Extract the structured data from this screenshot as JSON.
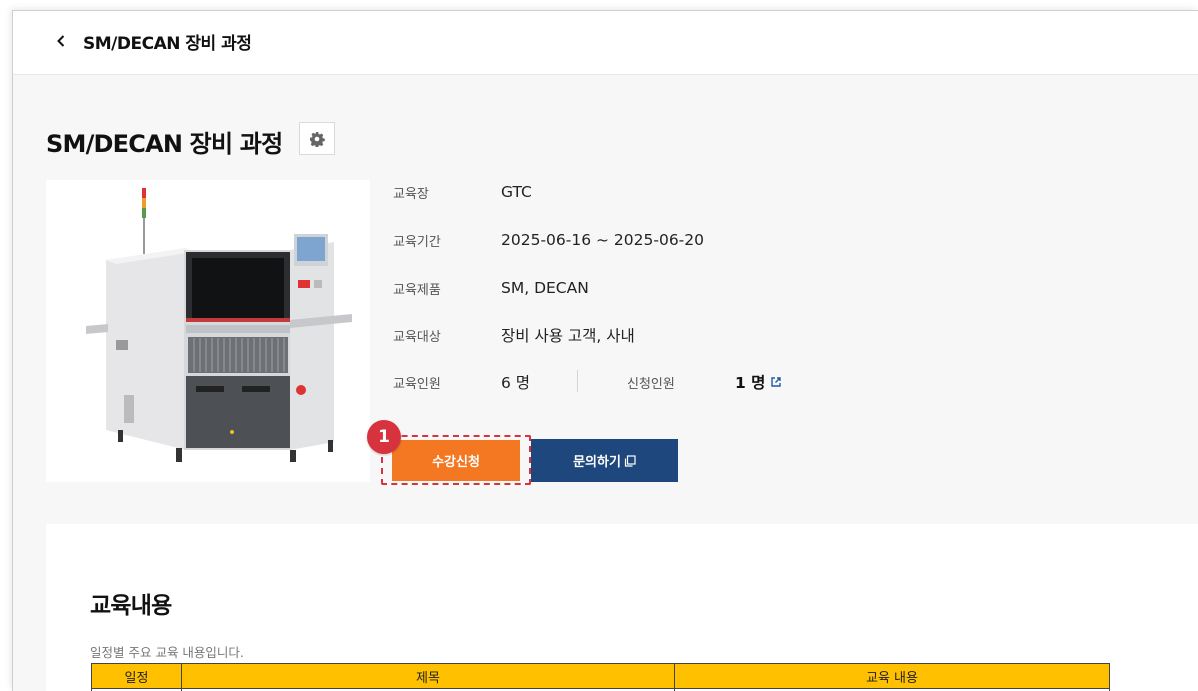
{
  "header": {
    "title": "SM/DECAN 장비 과정"
  },
  "course": {
    "title": "SM/DECAN 장비 과정",
    "info": {
      "venue_label": "교육장",
      "venue_value": "GTC",
      "period_label": "교육기간",
      "period_value": "2025-06-16 ~ 2025-06-20",
      "products_label": "교육제품",
      "products_value": "SM, DECAN",
      "target_label": "교육대상",
      "target_value": "장비 사용 고객, 사내",
      "capacity_label": "교육인원",
      "capacity_value": "6 명",
      "applied_label": "신청인원",
      "applied_value": "1 명"
    },
    "buttons": {
      "apply": "수강신청",
      "inquiry": "문의하기"
    },
    "step_badge": "1"
  },
  "content": {
    "title": "교육내용",
    "subtitle": "일정별 주요 교육 내용입니다.",
    "table_headers": [
      "일정",
      "제목",
      "교육 내용"
    ]
  },
  "colors": {
    "apply_button": "#f47721",
    "inquiry_button": "#1e477d",
    "highlight": "#d9333f",
    "table_header": "#ffc000"
  },
  "icons": {
    "back": "chevron-left-icon",
    "settings": "gear-icon",
    "external": "external-link-icon",
    "copy": "copy-icon"
  }
}
